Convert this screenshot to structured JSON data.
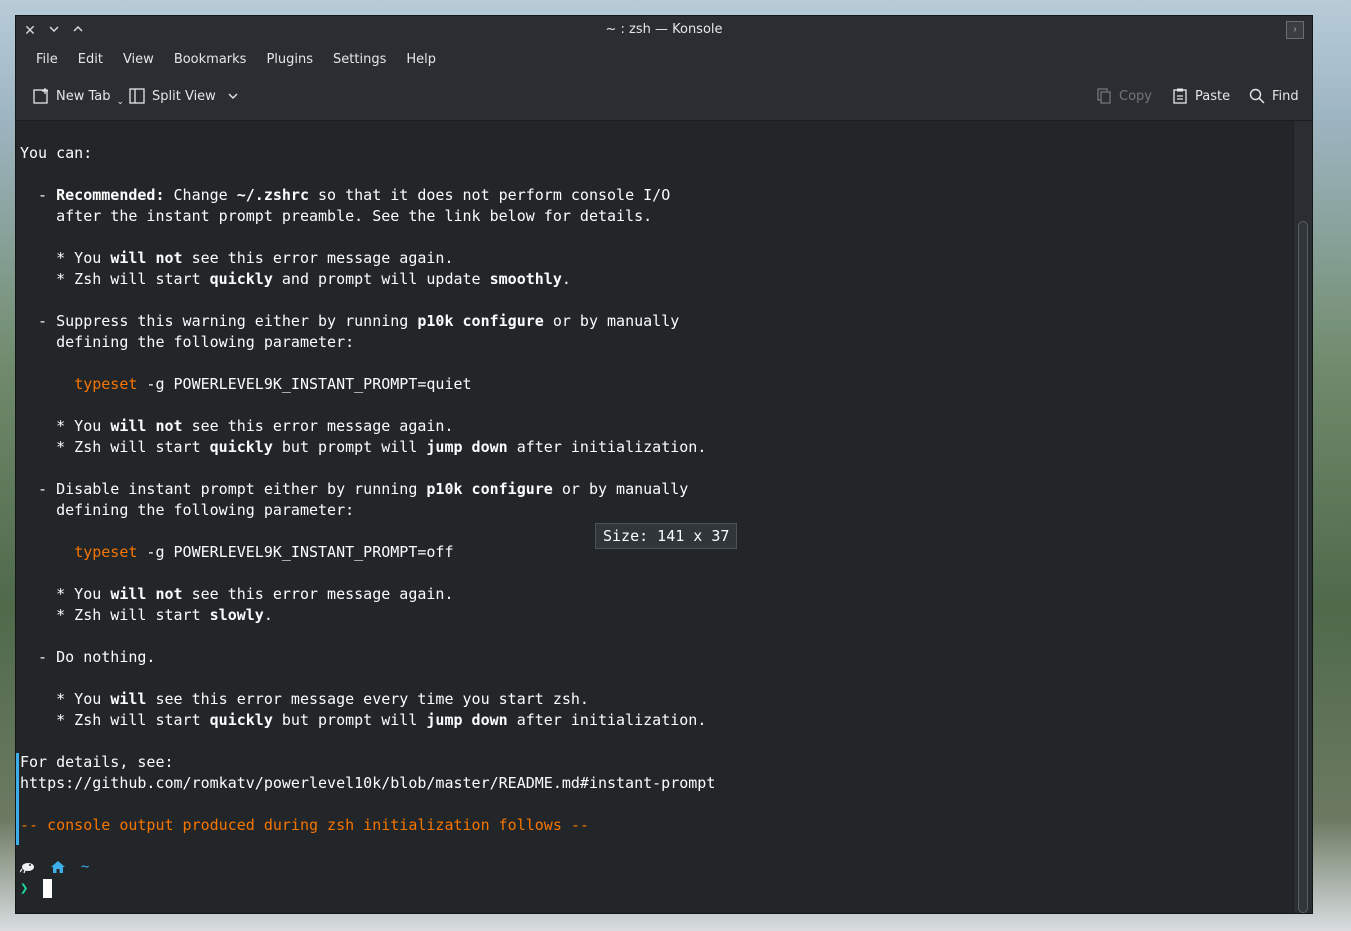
{
  "window": {
    "title": "~ : zsh — Konsole",
    "controls": [
      "close",
      "minimize",
      "maximize"
    ]
  },
  "menubar": {
    "items": [
      "File",
      "Edit",
      "View",
      "Bookmarks",
      "Plugins",
      "Settings",
      "Help"
    ]
  },
  "toolbar": {
    "new_tab": "New Tab",
    "split_view": "Split View",
    "copy": "Copy",
    "paste": "Paste",
    "find": "Find"
  },
  "terminal": {
    "lines": [
      [
        {
          "t": "You can:"
        }
      ],
      [
        {
          "t": ""
        }
      ],
      [
        {
          "t": "  - "
        },
        {
          "t": "Recommended:",
          "b": true
        },
        {
          "t": " Change "
        },
        {
          "t": "~/.zshrc",
          "b": true
        },
        {
          "t": " so that it does not perform console I/O"
        }
      ],
      [
        {
          "t": "    after the instant prompt preamble. See the link below for details."
        }
      ],
      [
        {
          "t": ""
        }
      ],
      [
        {
          "t": "    * You "
        },
        {
          "t": "will not",
          "b": true
        },
        {
          "t": " see this error message again."
        }
      ],
      [
        {
          "t": "    * Zsh will start "
        },
        {
          "t": "quickly",
          "b": true
        },
        {
          "t": " and prompt will update "
        },
        {
          "t": "smoothly",
          "b": true
        },
        {
          "t": "."
        }
      ],
      [
        {
          "t": ""
        }
      ],
      [
        {
          "t": "  - Suppress this warning either by running "
        },
        {
          "t": "p10k configure",
          "b": true
        },
        {
          "t": " or by manually"
        }
      ],
      [
        {
          "t": "    defining the following parameter:"
        }
      ],
      [
        {
          "t": ""
        }
      ],
      [
        {
          "t": "      "
        },
        {
          "t": "typeset",
          "c": "orange"
        },
        {
          "t": " -g POWERLEVEL9K_INSTANT_PROMPT=quiet"
        }
      ],
      [
        {
          "t": ""
        }
      ],
      [
        {
          "t": "    * You "
        },
        {
          "t": "will not",
          "b": true
        },
        {
          "t": " see this error message again."
        }
      ],
      [
        {
          "t": "    * Zsh will start "
        },
        {
          "t": "quickly",
          "b": true
        },
        {
          "t": " but prompt will "
        },
        {
          "t": "jump down",
          "b": true
        },
        {
          "t": " after initialization."
        }
      ],
      [
        {
          "t": ""
        }
      ],
      [
        {
          "t": "  - Disable instant prompt either by running "
        },
        {
          "t": "p10k configure",
          "b": true
        },
        {
          "t": " or by manually"
        }
      ],
      [
        {
          "t": "    defining the following parameter:"
        }
      ],
      [
        {
          "t": ""
        }
      ],
      [
        {
          "t": "      "
        },
        {
          "t": "typeset",
          "c": "orange"
        },
        {
          "t": " -g POWERLEVEL9K_INSTANT_PROMPT=off"
        }
      ],
      [
        {
          "t": ""
        }
      ],
      [
        {
          "t": "    * You "
        },
        {
          "t": "will not",
          "b": true
        },
        {
          "t": " see this error message again."
        }
      ],
      [
        {
          "t": "    * Zsh will start "
        },
        {
          "t": "slowly",
          "b": true
        },
        {
          "t": "."
        }
      ],
      [
        {
          "t": ""
        }
      ],
      [
        {
          "t": "  - Do nothing."
        }
      ],
      [
        {
          "t": ""
        }
      ],
      [
        {
          "t": "    * You "
        },
        {
          "t": "will",
          "b": true
        },
        {
          "t": " see this error message every time you start zsh."
        }
      ],
      [
        {
          "t": "    * Zsh will start "
        },
        {
          "t": "quickly",
          "b": true
        },
        {
          "t": " but prompt will "
        },
        {
          "t": "jump down",
          "b": true
        },
        {
          "t": " after initialization."
        }
      ],
      [
        {
          "t": ""
        }
      ],
      [
        {
          "t": "For details, see:"
        }
      ],
      [
        {
          "t": "https://github.com/romkatv/powerlevel10k/blob/master/README.md#instant-prompt"
        }
      ],
      [
        {
          "t": ""
        }
      ],
      [
        {
          "t": "-- console output produced during zsh initialization follows --",
          "c": "orange"
        }
      ]
    ],
    "size_tooltip": "Size: 141 x 37",
    "prompt_dir": "~",
    "prompt_char": "❯"
  },
  "colors": {
    "background": "#232629",
    "foreground": "#fcfcfc",
    "orange": "#f67400",
    "accent": "#3daee9",
    "prompt_green": "#1cdc9a"
  }
}
